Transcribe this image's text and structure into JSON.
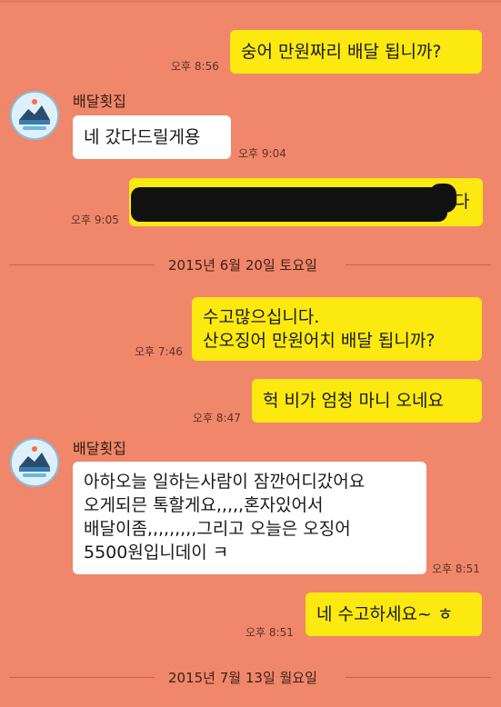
{
  "chat": {
    "messages": [
      {
        "text": "숭어 만원짜리 배달 됩니까?",
        "time": "오후 8:56"
      },
      {
        "sender": "배달횟집",
        "text": "네 갔다드릴게용",
        "time": "오후 9:04"
      },
      {
        "text": "다",
        "time": "오후 9:05"
      },
      {
        "text": "수고많으십니다.\n산오징어 만원어치 배달 됩니까?",
        "time": "오후 7:46"
      },
      {
        "text": "헉 비가 엄청 마니 오네요",
        "time": "오후 8:47"
      },
      {
        "sender": "배달횟집",
        "text": "아하오늘 일하는사람이 잠깐어디갔어요\n오게되믄 톡할게요,,,,,혼자있어서\n배달이좀,,,,,,,,,그리고 오늘은 오징어\n5500원입니데이 ㅋ",
        "time": "오후 8:51"
      },
      {
        "text": "네 수고하세요~ ㅎ",
        "time": "오후 8:51"
      }
    ],
    "dates": [
      "2015년 6월 20일 토요일",
      "2015년 7월 13일 월요일"
    ]
  },
  "colors": {
    "background": "#f0876a",
    "outgoing_bubble": "#fbe90f",
    "incoming_bubble": "#ffffff"
  },
  "icons": {
    "avatar": "shop-logo-icon"
  }
}
